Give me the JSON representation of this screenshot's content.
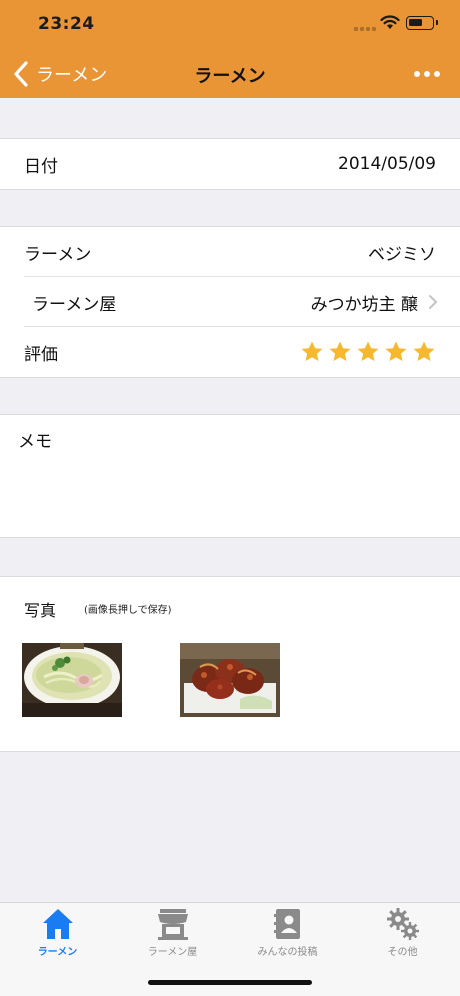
{
  "status_bar": {
    "time": "23:24"
  },
  "nav": {
    "back_label": "ラーメン",
    "title": "ラーメン"
  },
  "date_section": {
    "label": "日付",
    "value": "2014/05/09"
  },
  "detail_section": {
    "ramen_label": "ラーメン",
    "ramen_value": "ベジミソ",
    "shop_label": "ラーメン屋",
    "shop_value": "みつか坊主 醸",
    "rating_label": "評価",
    "rating": 5,
    "rating_max": 5,
    "star_color": "#f5b82e"
  },
  "memo_section": {
    "label": "メモ"
  },
  "photo_section": {
    "title": "写真",
    "hint": "(画像長押しで保存)",
    "photos": [
      "ramen-bowl-photo",
      "karaage-photo"
    ]
  },
  "tab_bar": {
    "tabs": [
      {
        "label": "ラーメン",
        "icon": "house-icon",
        "active": true
      },
      {
        "label": "ラーメン屋",
        "icon": "shop-icon",
        "active": false
      },
      {
        "label": "みんなの投稿",
        "icon": "contacts-book-icon",
        "active": false
      },
      {
        "label": "その他",
        "icon": "gears-icon",
        "active": false
      }
    ]
  },
  "colors": {
    "accent": "#e99435",
    "tab_active": "#1a7cf2",
    "tab_inactive": "#8a8a8a",
    "background": "#efeff4"
  }
}
